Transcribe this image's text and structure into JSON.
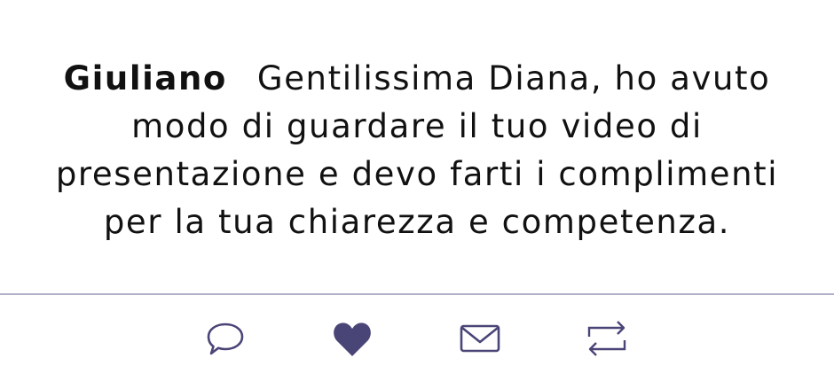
{
  "post": {
    "author": "Giuliano",
    "text": "Gentilissima Diana, ho avuto modo di guardare il tuo video di presentazione e devo farti i complimenti per la tua chiarezza e competenza."
  },
  "actions": [
    {
      "icon": "comment-icon"
    },
    {
      "icon": "heart-icon"
    },
    {
      "icon": "mail-icon"
    },
    {
      "icon": "repost-icon"
    }
  ],
  "colors": {
    "icon": "#4a4577",
    "divider": "#b3b0c9",
    "text": "#111111"
  }
}
